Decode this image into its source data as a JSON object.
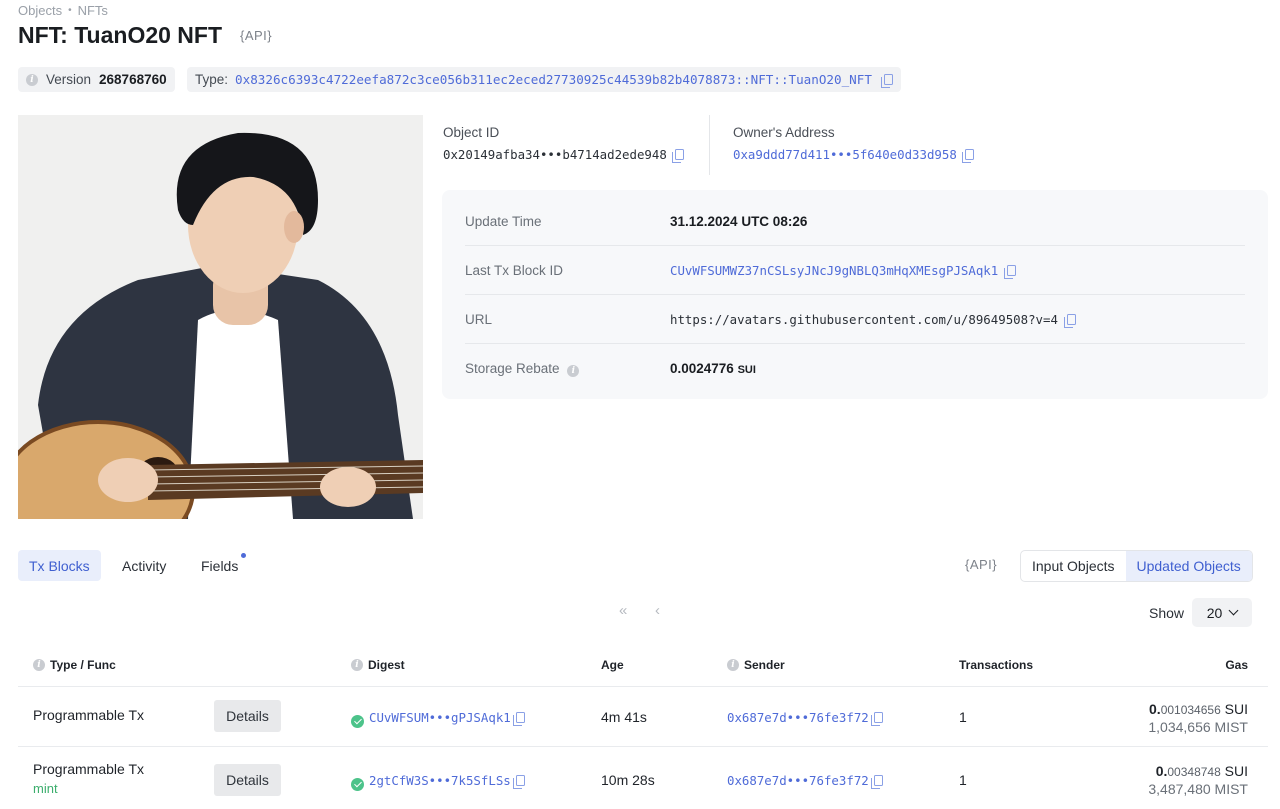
{
  "breadcrumb": [
    "Objects",
    "NFTs"
  ],
  "title": "NFT: TuanO20 NFT",
  "api_label": "{API}",
  "version": {
    "label": "Version",
    "value": "268768760"
  },
  "type": {
    "label": "Type:",
    "value": "0x8326c6393c4722eefa872c3ce056b311ec2eced27730925c44539b82b4078873::NFT::TuanO20_NFT"
  },
  "object_id": {
    "label": "Object ID",
    "value": "0x20149afba34•••b4714ad2ede948"
  },
  "owner": {
    "label": "Owner's Address",
    "value": "0xa9ddd77d411•••5f640e0d33d958"
  },
  "details": {
    "update_time": {
      "label": "Update Time",
      "value": "31.12.2024 UTC 08:26"
    },
    "last_tx": {
      "label": "Last Tx Block ID",
      "value": "CUvWFSUMWZ37nCSLsyJNcJ9gNBLQ3mHqXMEsgPJSAqk1"
    },
    "url": {
      "label": "URL",
      "value": "https://avatars.githubusercontent.com/u/89649508?v=4"
    },
    "storage_rebate": {
      "label": "Storage Rebate",
      "value": "0.0024776",
      "unit": "SUI"
    }
  },
  "tabs": {
    "tx_blocks": "Tx Blocks",
    "activity": "Activity",
    "fields": "Fields"
  },
  "objects_toggle": {
    "input": "Input Objects",
    "updated": "Updated Objects"
  },
  "pagination": {
    "first": "«",
    "prev": "‹",
    "show_label": "Show",
    "page_size": "20"
  },
  "table": {
    "headers": {
      "type_func": "Type / Func",
      "digest": "Digest",
      "age": "Age",
      "sender": "Sender",
      "transactions": "Transactions",
      "gas": "Gas"
    },
    "rows": [
      {
        "type": "Programmable Tx",
        "tag": "",
        "details": "Details",
        "digest": "CUvWFSUM•••gPJSAqk1",
        "age": "4m 41s",
        "sender": "0x687e7d•••76fe3f72",
        "transactions": "1",
        "gas_main": "0.",
        "gas_frac": "001034656",
        "gas_unit": "SUI",
        "gas_mist": "1,034,656 MIST"
      },
      {
        "type": "Programmable Tx",
        "tag": "mint",
        "details": "Details",
        "digest": "2gtCfW3S•••7k5SfLSs",
        "age": "10m 28s",
        "sender": "0x687e7d•••76fe3f72",
        "transactions": "1",
        "gas_main": "0.",
        "gas_frac": "00348748",
        "gas_unit": "SUI",
        "gas_mist": "3,487,480 MIST"
      }
    ]
  },
  "colors": {
    "accent": "#4f6bd8",
    "success": "#4cc38a",
    "panel_bg": "#f7f8fa"
  },
  "icons": [
    "info-icon",
    "copy-icon",
    "check-circle-icon",
    "chevron-down-icon"
  ]
}
